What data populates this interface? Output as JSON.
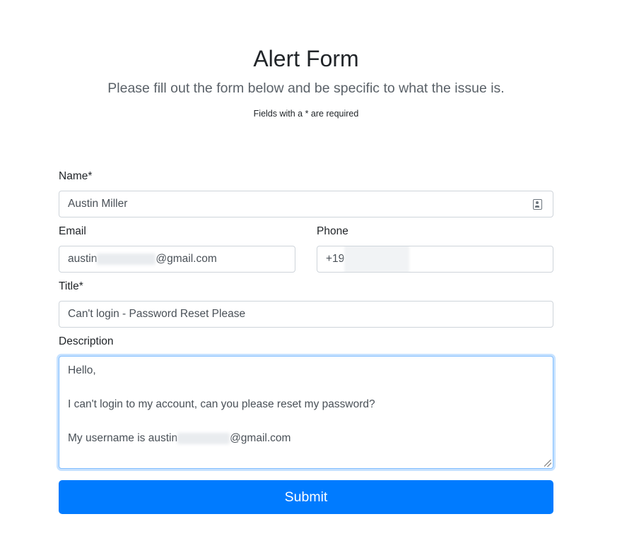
{
  "header": {
    "title": "Alert Form",
    "lead": "Please fill out the form below and be specific to what the issue is.",
    "note": "Fields with a * are required"
  },
  "form": {
    "name": {
      "label": "Name*",
      "value": "Austin Miller",
      "icon": "contact-card-icon"
    },
    "email": {
      "label": "Email",
      "value_prefix": "austin",
      "value_suffix": "@gmail.com"
    },
    "phone": {
      "label": "Phone",
      "value_prefix": "+19"
    },
    "title": {
      "label": "Title*",
      "value": "Can't login - Password Reset Please"
    },
    "description": {
      "label": "Description",
      "lines": [
        "Hello,",
        "",
        "I can't login to my account, can you  please reset my password?",
        "",
        "My username is austin"
      ],
      "last_line_suffix": "@gmail.com"
    },
    "submit_label": "Submit"
  },
  "colors": {
    "primary": "#007bff",
    "focus_border": "#80bdff",
    "input_border": "#ced4da"
  }
}
